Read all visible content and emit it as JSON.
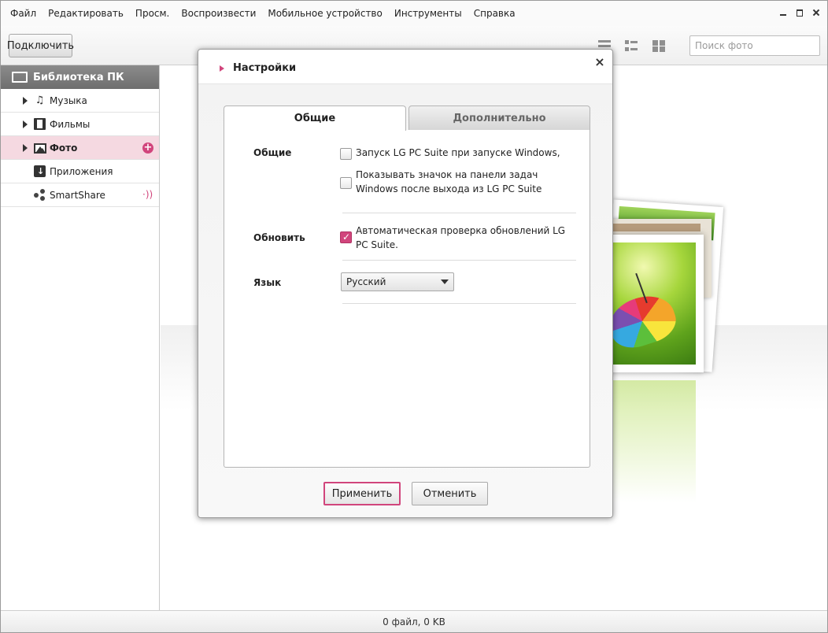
{
  "menu": [
    "Файл",
    "Редактировать",
    "Просм.",
    "Воспроизвести",
    "Мобильное устройство",
    "Инструменты",
    "Справка"
  ],
  "toolbar": {
    "connect_label": "Подключить",
    "search_placeholder": "Поиск фото"
  },
  "sidebar": {
    "header": "Библиотека ПК",
    "items": [
      {
        "label": "Музыка",
        "icon": "music-note-icon"
      },
      {
        "label": "Фильмы",
        "icon": "film-icon"
      },
      {
        "label": "Фото",
        "icon": "photo-icon",
        "selected": true
      },
      {
        "label": "Приложения",
        "icon": "app-download-icon"
      },
      {
        "label": "SmartShare",
        "icon": "share-icon"
      }
    ]
  },
  "dialog": {
    "title": "Настройки",
    "tabs": [
      "Общие",
      "Дополнительно"
    ],
    "active_tab": "Общие",
    "general": {
      "section_label": "Общие",
      "options": [
        {
          "text": "Запуск LG PC Suite при запуске Windows,",
          "checked": false
        },
        {
          "text": "Показывать значок на панели задач Windows после выхода из LG PC Suite",
          "checked": false
        }
      ]
    },
    "update": {
      "section_label": "Обновить",
      "option": {
        "text": "Автоматическая проверка обновлений LG PC Suite.",
        "checked": true
      }
    },
    "language": {
      "section_label": "Язык",
      "selected": "Русский"
    },
    "apply_label": "Применить",
    "cancel_label": "Отменить"
  },
  "status": {
    "text": "0 файл, 0 KB"
  },
  "colors": {
    "accent": "#d1457c",
    "selected_row": "#f5d9e1",
    "header_gray": "#7a7a7a"
  }
}
